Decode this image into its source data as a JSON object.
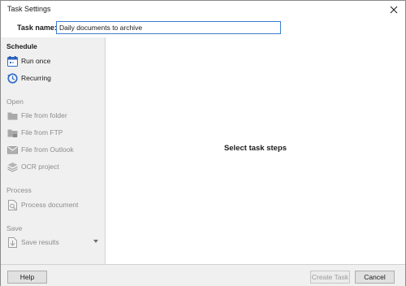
{
  "window": {
    "title": "Task Settings"
  },
  "task_name": {
    "label": "Task name:",
    "value": "Daily documents to archive"
  },
  "sidebar": {
    "schedule": {
      "heading": "Schedule",
      "items": [
        {
          "label": "Run once",
          "icon": "calendar-icon",
          "enabled": true
        },
        {
          "label": "Recurring",
          "icon": "recurring-icon",
          "enabled": true
        }
      ]
    },
    "open": {
      "heading": "Open",
      "items": [
        {
          "label": "File from folder",
          "icon": "folder-icon",
          "enabled": false
        },
        {
          "label": "File from FTP",
          "icon": "ftp-folder-icon",
          "enabled": false
        },
        {
          "label": "File from Outlook",
          "icon": "outlook-mail-icon",
          "enabled": false
        },
        {
          "label": "OCR project",
          "icon": "ocr-stack-icon",
          "enabled": false
        }
      ]
    },
    "process": {
      "heading": "Process",
      "items": [
        {
          "label": "Process document",
          "icon": "process-document-icon",
          "enabled": false
        }
      ]
    },
    "save": {
      "heading": "Save",
      "items": [
        {
          "label": "Save results",
          "icon": "save-document-icon",
          "enabled": false
        }
      ]
    }
  },
  "main": {
    "message": "Select task steps"
  },
  "footer": {
    "help": "Help",
    "create_task": "Create Task",
    "cancel": "Cancel"
  },
  "colors": {
    "sidebar_bg": "#f0f0f0",
    "accent_blue": "#2e6bc6",
    "disabled_text": "#8c8c8c",
    "input_border": "#3c7fcf"
  }
}
